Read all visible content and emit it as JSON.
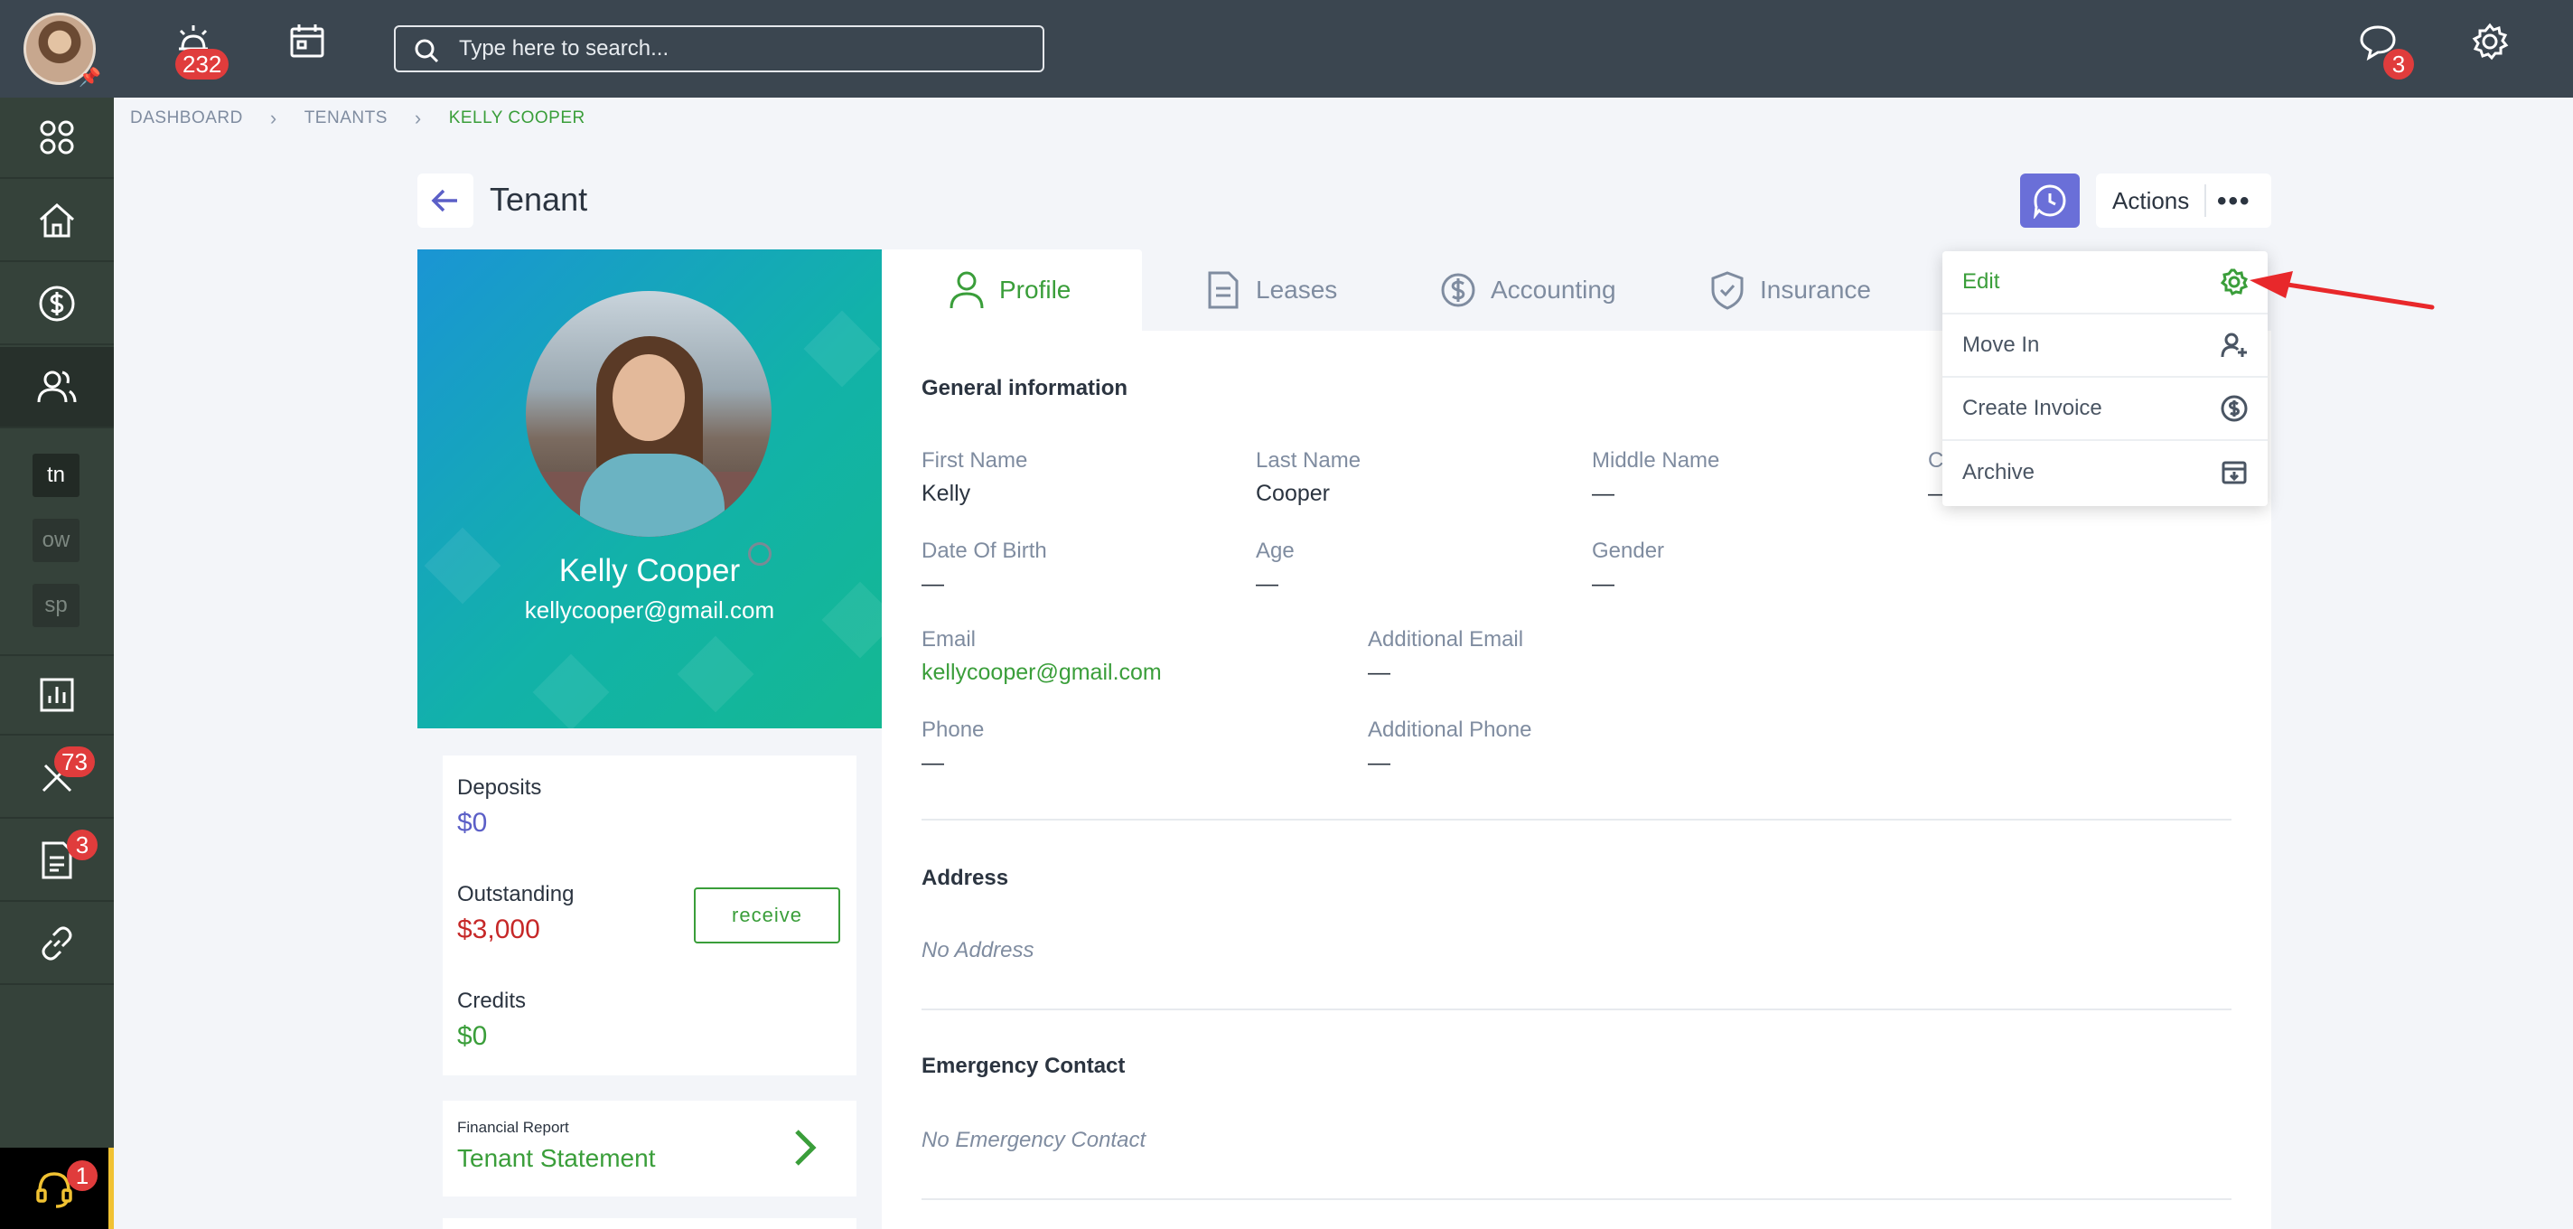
{
  "topbar": {
    "notifications_badge": "232",
    "search_placeholder": "Type here to search...",
    "messages_badge": "3"
  },
  "sidebar": {
    "tags": [
      "tn",
      "ow",
      "sp"
    ],
    "maintenance_badge": "73",
    "documents_badge": "3",
    "support_badge": "1"
  },
  "breadcrumb": [
    "DASHBOARD",
    "TENANTS",
    "KELLY COOPER"
  ],
  "header": {
    "title": "Tenant",
    "actions_label": "Actions",
    "more_label": "•••"
  },
  "profile": {
    "name": "Kelly Cooper",
    "email": "kellycooper@gmail.com"
  },
  "finance": {
    "deposits_label": "Deposits",
    "deposits_value": "$0",
    "outstanding_label": "Outstanding",
    "outstanding_value": "$3,000",
    "receive_label": "receive",
    "credits_label": "Credits",
    "credits_value": "$0",
    "report_small": "Financial Report",
    "report_link": "Tenant Statement"
  },
  "tabs": [
    "Profile",
    "Leases",
    "Accounting",
    "Insurance"
  ],
  "general": {
    "title": "General information",
    "first_name_label": "First Name",
    "first_name": "Kelly",
    "last_name_label": "Last Name",
    "last_name": "Cooper",
    "middle_name_label": "Middle Name",
    "middle_name": "—",
    "hidden_label_fragment": "C",
    "hidden_value_fragment": "—",
    "dob_label": "Date Of Birth",
    "dob": "—",
    "age_label": "Age",
    "age": "—",
    "gender_label": "Gender",
    "gender": "—",
    "email_label": "Email",
    "email": "kellycooper@gmail.com",
    "additional_email_label": "Additional Email",
    "additional_email": "—",
    "phone_label": "Phone",
    "phone": "—",
    "additional_phone_label": "Additional Phone",
    "additional_phone": "—"
  },
  "address": {
    "title": "Address",
    "empty": "No Address"
  },
  "emergency": {
    "title": "Emergency Contact",
    "empty": "No Emergency Contact"
  },
  "dropdown": {
    "items": [
      "Edit",
      "Move In",
      "Create Invoice",
      "Archive"
    ]
  },
  "colors": {
    "topbar": "#3b4650",
    "sidebar": "#35423a",
    "accent_green": "#3a9e3a",
    "accent_purple": "#6a6fd8",
    "danger_red": "#e03c3c",
    "annotation_arrow": "#e8282b"
  },
  "icons": {
    "topbar": [
      "alarm-icon",
      "calendar-icon",
      "search-icon",
      "chat-icon",
      "settings-gear-icon"
    ],
    "sidebar": [
      "dashboard-grid-icon",
      "home-icon",
      "dollar-icon",
      "users-icon",
      "chart-icon",
      "tools-icon",
      "document-icon",
      "link-icon",
      "headset-icon"
    ]
  }
}
